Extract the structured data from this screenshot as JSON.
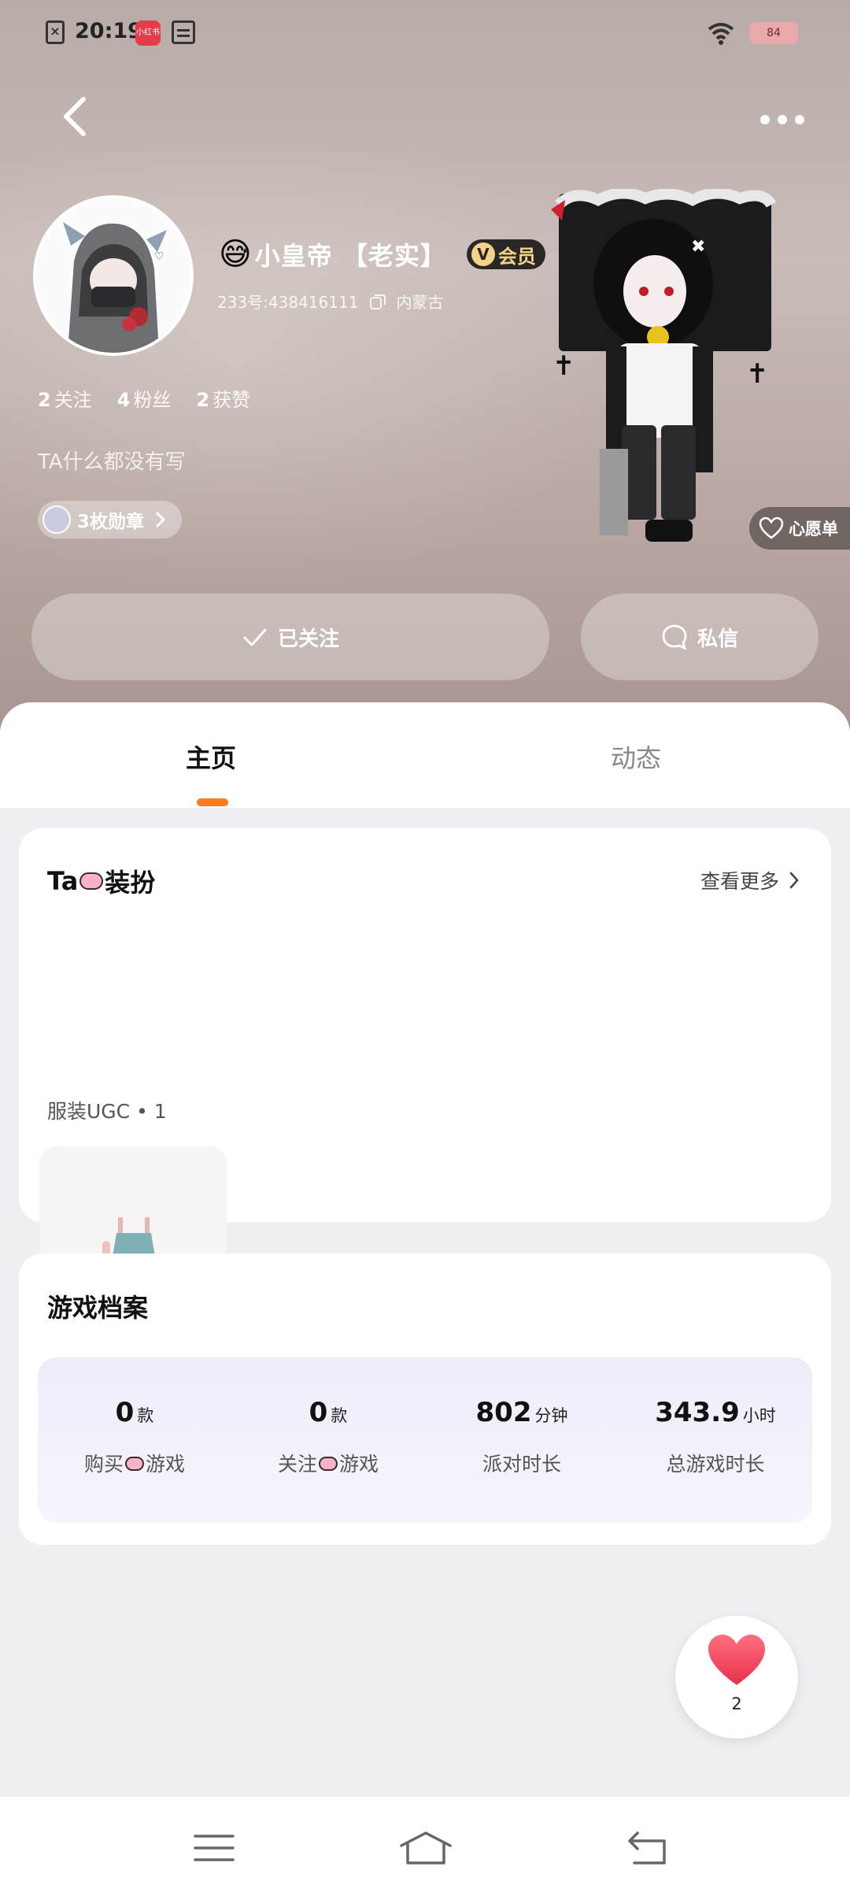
{
  "status_bar": {
    "time": "20:19",
    "app_badge": "小红书",
    "battery": "84",
    "icons": [
      "sim-off-icon",
      "calendar-icon",
      "wifi-icon",
      "battery-icon"
    ]
  },
  "topbar": {
    "back_icon": "chevron-left-icon",
    "more_icon": "more-dots-icon"
  },
  "profile": {
    "emoji": "😅",
    "name": "小皇帝 【老实】",
    "vip_label": "会员",
    "id_text": "233号:438416111",
    "location": "内蒙古",
    "stats": [
      {
        "count": "2",
        "label": "关注"
      },
      {
        "count": "4",
        "label": "粉丝"
      },
      {
        "count": "2",
        "label": "获赞"
      }
    ],
    "bio": "TA什么都没有写",
    "badges_label": "3枚勋章",
    "wishlist_label": "心愿单"
  },
  "actions": {
    "follow_label": "已关注",
    "message_label": "私信"
  },
  "tabs": {
    "home": "主页",
    "feed": "动态"
  },
  "outfit_card": {
    "title_prefix": "Ta",
    "title_suffix": "装扮",
    "see_more": "查看更多",
    "ugc_label": "服装UGC • 1"
  },
  "game_card": {
    "title": "游戏档案",
    "stats": [
      {
        "num": "0",
        "unit": "款",
        "label_prefix": "购买",
        "label_suffix": "游戏"
      },
      {
        "num": "0",
        "unit": "款",
        "label_prefix": "关注",
        "label_suffix": "游戏"
      },
      {
        "num": "802",
        "unit": "分钟",
        "label": "派对时长"
      },
      {
        "num": "343.9",
        "unit": "小时",
        "label": "总游戏时长"
      }
    ]
  },
  "like_fab": {
    "count": "2"
  },
  "colors": {
    "accent": "#ff7a1a",
    "vip_gold": "#f4d28a",
    "like_red": "#f0485f"
  }
}
